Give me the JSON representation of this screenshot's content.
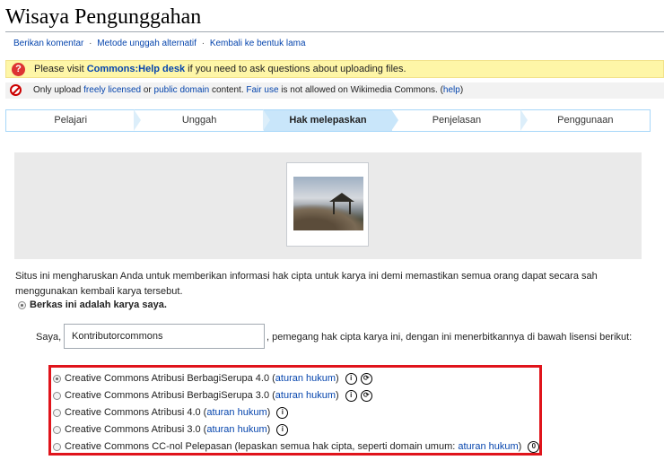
{
  "page": {
    "title": "Wisaya Pengunggahan"
  },
  "sublinks": [
    "Berikan komentar",
    "Metode unggah alternatif",
    "Kembali ke bentuk lama"
  ],
  "sublink_separator": "·",
  "help": {
    "prefix": "Please visit ",
    "link": "Commons:Help desk",
    "suffix": " if you need to ask questions about uploading files."
  },
  "license_note": {
    "t1": "Only upload ",
    "l1": "freely licensed",
    "t2": " or ",
    "l2": "public domain",
    "t3": " content. ",
    "l3": "Fair use",
    "t4": " is not allowed on Wikimedia Commons. (",
    "l4": "help",
    "t5": ")"
  },
  "steps": [
    "Pelajari",
    "Unggah",
    "Hak melepaskan",
    "Penjelasan",
    "Penggunaan"
  ],
  "active_step": "Hak melepaskan",
  "description": "Situs ini mengharuskan Anda untuk memberikan informasi hak cipta untuk karya ini demi memastikan semua orang dapat secara sah menggunakan kembali karya tersebut.",
  "own_work_label": "Berkas ini adalah karya saya.",
  "saya_label": "Saya,",
  "author_input_value": "Kontributorcommons",
  "after_input_text": ", pemegang hak cipta karya ini, dengan ini menerbitkannya di bawah lisensi berikut:",
  "licenses": [
    {
      "label": "Creative Commons Atribusi BerbagiSerupa 4.0 (",
      "link": "aturan hukum",
      "close": ")",
      "selected": true
    },
    {
      "label": "Creative Commons Atribusi BerbagiSerupa 3.0 (",
      "link": "aturan hukum",
      "close": ")",
      "selected": false
    },
    {
      "label": "Creative Commons Atribusi 4.0 (",
      "link": "aturan hukum",
      "close": ")",
      "selected": false
    },
    {
      "label": "Creative Commons Atribusi 3.0 (",
      "link": "aturan hukum",
      "close": ")",
      "selected": false
    },
    {
      "label": "Creative Commons CC-nol Pelepasan (lepaskan semua hak cipta, seperti domain umum: ",
      "link": "aturan hukum",
      "close": ")",
      "selected": false
    }
  ],
  "colors": {
    "highlight_border": "#e0141b",
    "link": "#0645ad",
    "active_step_bg": "#c9e6fa"
  },
  "icons": {
    "help": "question-icon",
    "no_fair_use": "prohibited-icon",
    "by": "cc-by-icon",
    "sa": "cc-sa-icon",
    "zero": "cc-zero-icon"
  }
}
